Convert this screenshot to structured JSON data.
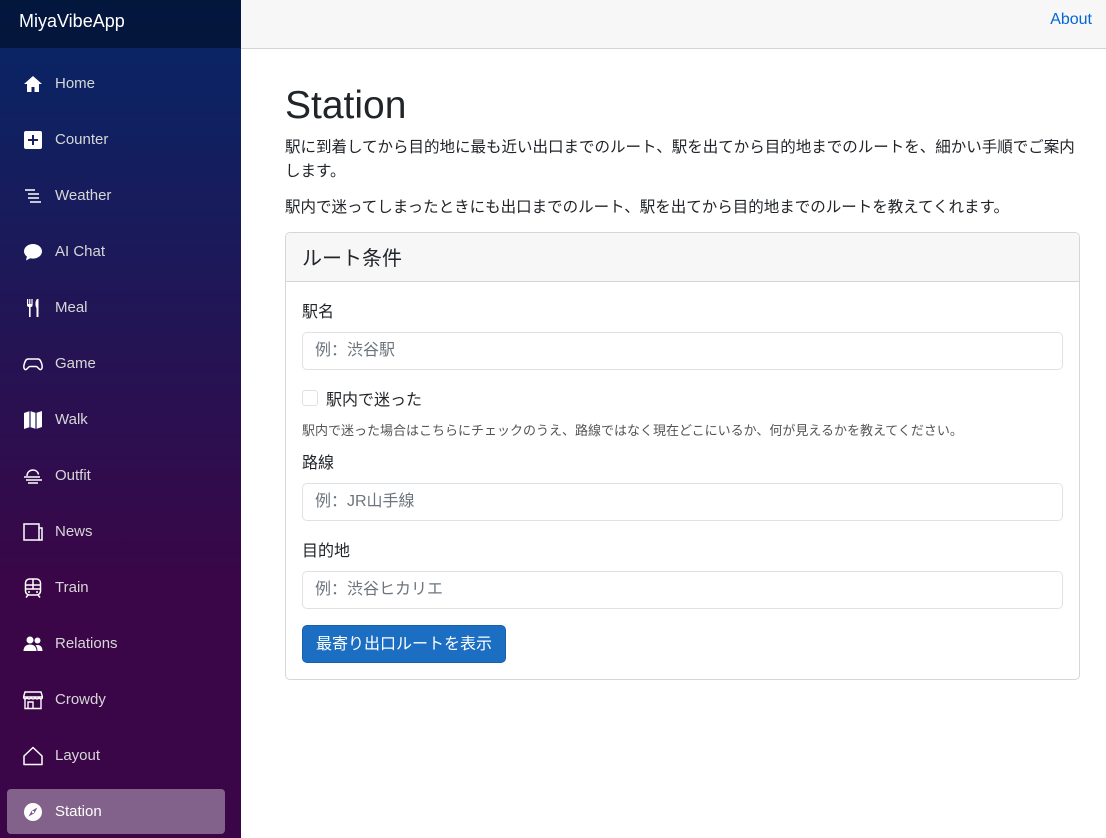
{
  "app": {
    "brand": "MiyaVibeApp"
  },
  "topbar": {
    "about": "About"
  },
  "nav": [
    {
      "label": "Home",
      "icon": "home-icon"
    },
    {
      "label": "Counter",
      "icon": "plus-square-icon"
    },
    {
      "label": "Weather",
      "icon": "list-lines-icon"
    },
    {
      "label": "AI Chat",
      "icon": "chat-bubble-icon"
    },
    {
      "label": "Meal",
      "icon": "fork-knife-icon"
    },
    {
      "label": "Game",
      "icon": "gamepad-icon"
    },
    {
      "label": "Walk",
      "icon": "map-icon"
    },
    {
      "label": "Outfit",
      "icon": "wind-cloud-icon"
    },
    {
      "label": "News",
      "icon": "newspaper-icon"
    },
    {
      "label": "Train",
      "icon": "train-icon"
    },
    {
      "label": "Relations",
      "icon": "people-icon"
    },
    {
      "label": "Crowdy",
      "icon": "shop-icon"
    },
    {
      "label": "Layout",
      "icon": "house-outline-icon"
    },
    {
      "label": "Station",
      "icon": "compass-icon",
      "active": true
    }
  ],
  "page": {
    "title": "Station",
    "desc1": "駅に到着してから目的地に最も近い出口までのルート、駅を出てから目的地までのルートを、細かい手順でご案内します。",
    "desc2": "駅内で迷ってしまったときにも出口までのルート、駅を出てから目的地までのルートを教えてくれます。"
  },
  "form": {
    "header": "ルート条件",
    "station_label": "駅名",
    "station_placeholder": "例：渋谷駅",
    "lost_label": "駅内で迷った",
    "lost_help": "駅内で迷った場合はこちらにチェックのうえ、路線ではなく現在どこにいるか、何が見えるかを教えてください。",
    "line_label": "路線",
    "line_placeholder": "例：JR山手線",
    "dest_label": "目的地",
    "dest_placeholder": "例：渋谷ヒカリエ",
    "submit": "最寄り出口ルートを表示"
  },
  "colors": {
    "accent": "#1b6ec2",
    "link": "#0366d6",
    "sidebar_top": "#052767",
    "sidebar_bottom": "#3a0647"
  }
}
